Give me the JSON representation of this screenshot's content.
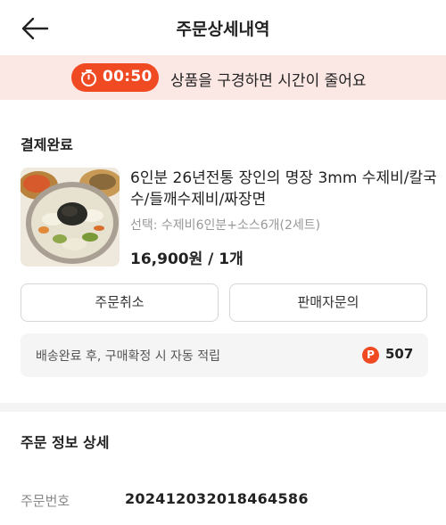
{
  "header": {
    "title": "주문상세내역",
    "back_icon": "arrow-left-icon"
  },
  "banner": {
    "timer": "00:50",
    "timer_icon": "stopwatch-icon",
    "message": "상품을 구경하면 시간이 줄어요",
    "accent_color": "#f04a23",
    "background_color": "#fbe7e4"
  },
  "order": {
    "status": "결제완료",
    "product_name": "6인분 26년전통 장인의 명장 3mm 수제비/칼국수/들깨수제비/짜장면",
    "option": "선택: 수제비6인분+소스6개(2세트)",
    "price_qty": "16,900원 / 1개"
  },
  "actions": {
    "cancel_label": "주문취소",
    "ask_seller_label": "판매자문의"
  },
  "points": {
    "text": "배송완료 후, 구매확정 시 자동 적립",
    "icon_letter": "P",
    "value": "507"
  },
  "details": {
    "section_title": "주문 정보 상세",
    "order_number_label": "주문번호",
    "order_number": "20241203201846​4586"
  }
}
